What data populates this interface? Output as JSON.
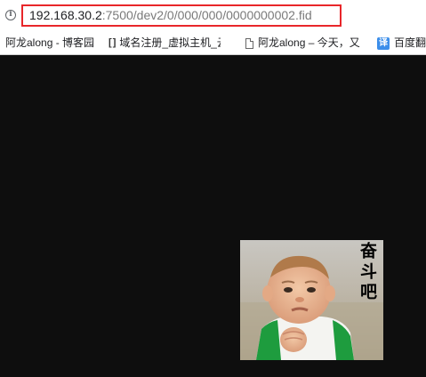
{
  "address_bar": {
    "url_host": "192.168.30.2",
    "url_path": ":7500/dev2/0/000/000/0000000002.fid",
    "info_icon": "info-icon",
    "highlight_color": "#e8262a"
  },
  "bookmarks": [
    {
      "label": "阿龙along - 博客园",
      "icon": "none"
    },
    {
      "label": "域名注册_虚拟主机_云",
      "icon": "cc-icon"
    },
    {
      "label": "阿龙along – 今天，又",
      "icon": "page-icon"
    },
    {
      "label": "百度翻",
      "icon": "translate-icon"
    }
  ],
  "content": {
    "background": "#0e0e0e",
    "image_caption": "奋斗吧"
  }
}
